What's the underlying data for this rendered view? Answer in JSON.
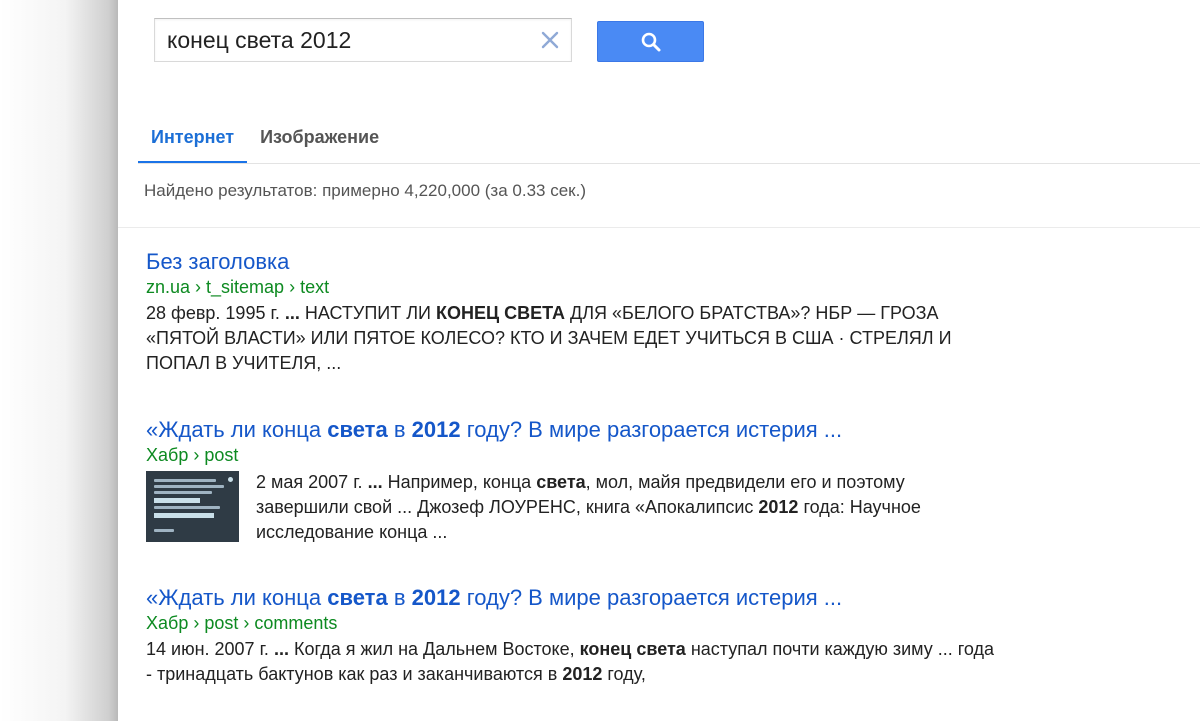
{
  "search": {
    "query": "конец света 2012",
    "clear_icon": "close-icon",
    "button_icon": "search-icon"
  },
  "tabs": [
    {
      "label": "Интернет",
      "active": true
    },
    {
      "label": "Изображение",
      "active": false
    }
  ],
  "stats": "Найдено результатов: примерно 4,220,000 (за 0.33 сек.)",
  "results": [
    {
      "title": "Без заголовка",
      "url": "zn.ua › t_sitemap › text",
      "snippet": {
        "date": "28 февр. 1995 г.",
        "ellipsis": "...",
        "before": "НАСТУПИТ ЛИ",
        "bold": "КОНЕЦ СВЕТА",
        "after": "ДЛЯ «БЕЛОГО БРАТСТВА»? НБР — ГРОЗА «ПЯТОЙ ВЛАСТИ» ИЛИ ПЯТОЕ КОЛЕСО? КТО И ЗАЧЕМ ЕДЕТ УЧИТЬСЯ В США · СТРЕЛЯЛ И ПОПАЛ В УЧИТЕЛЯ, ..."
      }
    },
    {
      "title": {
        "p1": "«Ждать ли конца",
        "b1": "света",
        "p2": "в",
        "b2": "2012",
        "p3": "году? В мире разгорается истерия ..."
      },
      "url": "Хабр › post",
      "snippet": {
        "date": "2 мая 2007 г.",
        "ellipsis": "...",
        "p1": "Например, конца",
        "b1": "света",
        "p2": ", мол, майя предвидели его и поэтому завершили свой ... Джозеф ЛОУРЕНС, книга «Апокалипсис",
        "b2": "2012",
        "p3": "года: Научное исследование конца ..."
      }
    },
    {
      "title": {
        "p1": "«Ждать ли конца",
        "b1": "света",
        "p2": "в",
        "b2": "2012",
        "p3": "году? В мире разгорается истерия ..."
      },
      "url": "Хабр › post › comments",
      "snippet": {
        "date": "14 июн. 2007 г.",
        "ellipsis": "...",
        "p1": "Когда я жил на Дальнем Востоке,",
        "b1": "конец света",
        "p2": "наступал почти каждую зиму ... года - тринадцать бактунов как раз и заканчиваются в",
        "b2": "2012",
        "p3": "году,"
      }
    }
  ],
  "colors": {
    "link": "#1557c9",
    "url": "#0d8a21",
    "accent": "#4a8af4"
  }
}
